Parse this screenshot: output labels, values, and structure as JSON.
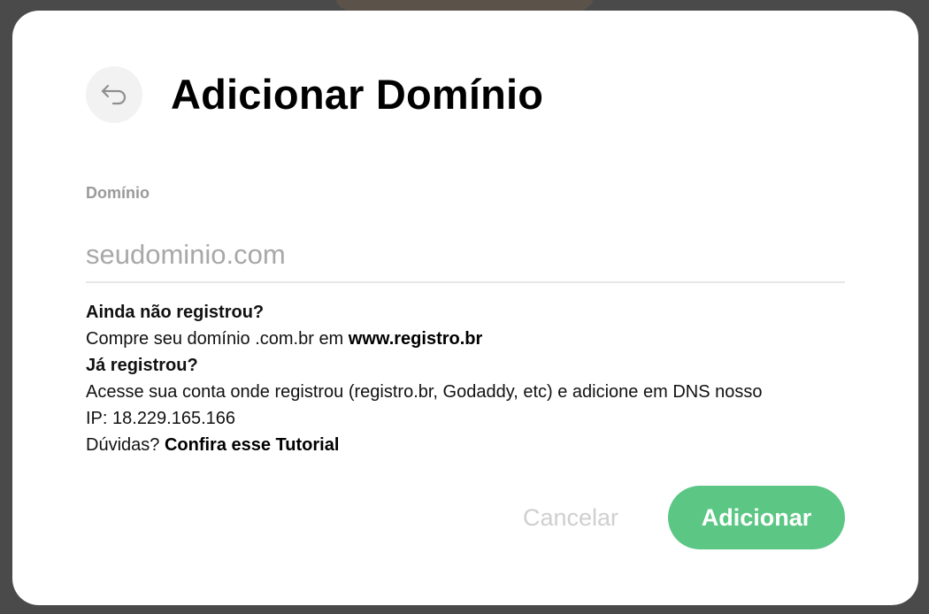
{
  "modal": {
    "title": "Adicionar Domínio",
    "back_icon": "undo-arrow-icon"
  },
  "form": {
    "domain_label": "Domínio",
    "domain_placeholder": "seudominio.com",
    "domain_value": ""
  },
  "info": {
    "not_registered_heading": "Ainda não registrou?",
    "buy_text": "Compre seu domínio .com.br em ",
    "registro_link": "www.registro.br",
    "registered_heading": "Já registrou?",
    "dns_text_line1": "Acesse sua conta onde registrou (registro.br, Godaddy, etc) e adicione em DNS nosso",
    "dns_text_line2": "IP: 18.229.165.166",
    "doubts_text": "Dúvidas? ",
    "tutorial_link": "Confira esse Tutorial"
  },
  "actions": {
    "cancel_label": "Cancelar",
    "add_label": "Adicionar"
  },
  "colors": {
    "accent": "#5cc685",
    "overlay": "#4a4a4a"
  }
}
